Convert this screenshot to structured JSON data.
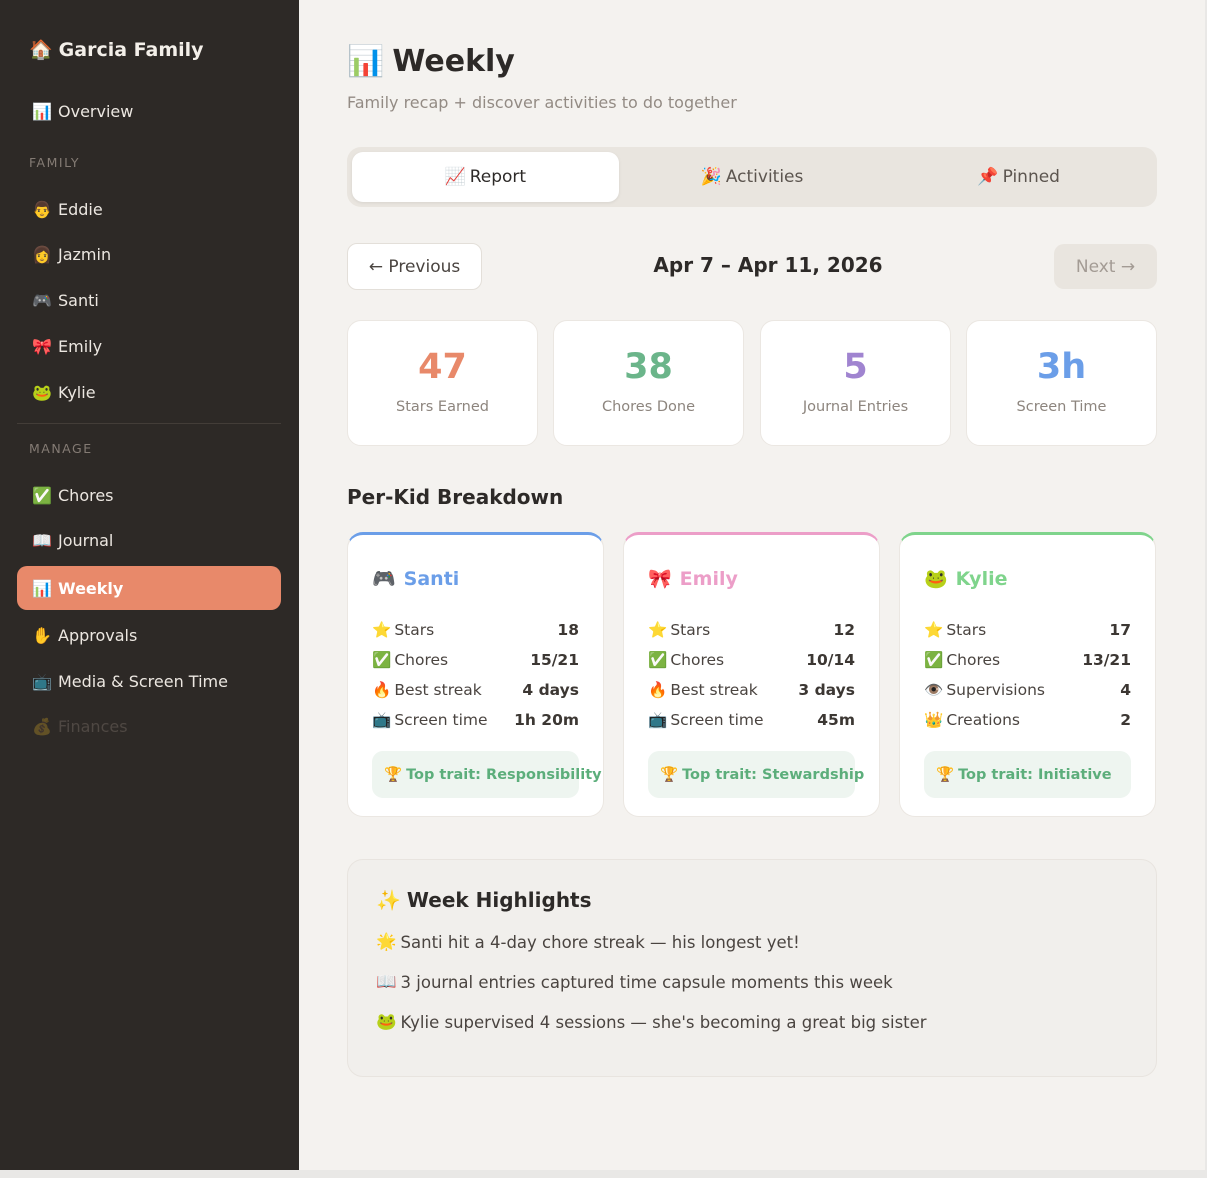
{
  "sidebar": {
    "brand": {
      "icon": "🏠",
      "label": "Garcia Family"
    },
    "overview": {
      "icon": "📊",
      "label": "Overview"
    },
    "family_label": "FAMILY",
    "family": [
      {
        "icon": "👨",
        "label": "Eddie"
      },
      {
        "icon": "👩",
        "label": "Jazmin"
      },
      {
        "icon": "🎮",
        "label": "Santi"
      },
      {
        "icon": "🎀",
        "label": "Emily"
      },
      {
        "icon": "🐸",
        "label": "Kylie"
      }
    ],
    "manage_label": "MANAGE",
    "manage": [
      {
        "icon": "✅",
        "label": "Chores"
      },
      {
        "icon": "📖",
        "label": "Journal"
      },
      {
        "icon": "📊",
        "label": "Weekly",
        "active": true
      },
      {
        "icon": "✋",
        "label": "Approvals"
      },
      {
        "icon": "📺",
        "label": "Media & Screen Time"
      },
      {
        "icon": "💰",
        "label": "Finances",
        "muted": true
      }
    ]
  },
  "header": {
    "icon": "📊",
    "title": "Weekly",
    "subtitle": "Family recap + discover activities to do together"
  },
  "tabs": [
    {
      "icon": "📈",
      "label": "Report",
      "active": true
    },
    {
      "icon": "🎉",
      "label": "Activities"
    },
    {
      "icon": "📌",
      "label": "Pinned"
    }
  ],
  "nav": {
    "prev": "← Previous",
    "next": "Next →",
    "date_range": "Apr 7 – Apr 11, 2026"
  },
  "stats": [
    {
      "value": "47",
      "label": "Stars Earned",
      "color": "#e8896a"
    },
    {
      "value": "38",
      "label": "Chores Done",
      "color": "#6bb58a"
    },
    {
      "value": "5",
      "label": "Journal Entries",
      "color": "#a084d0"
    },
    {
      "value": "3h",
      "label": "Screen Time",
      "color": "#6b9ee8"
    }
  ],
  "breakdown": {
    "title": "Per-Kid Breakdown",
    "kids": [
      {
        "icon": "🎮",
        "name": "Santi",
        "color": "#6b9ee8",
        "rows": [
          {
            "icon": "⭐",
            "label": "Stars",
            "value": "18"
          },
          {
            "icon": "✅",
            "label": "Chores",
            "value": "15/21"
          },
          {
            "icon": "🔥",
            "label": "Best streak",
            "value": "4 days"
          },
          {
            "icon": "📺",
            "label": "Screen time",
            "value": "1h 20m"
          }
        ],
        "trait": "Top trait: Responsibility"
      },
      {
        "icon": "🎀",
        "name": "Emily",
        "color": "#ec9ec8",
        "rows": [
          {
            "icon": "⭐",
            "label": "Stars",
            "value": "12"
          },
          {
            "icon": "✅",
            "label": "Chores",
            "value": "10/14"
          },
          {
            "icon": "🔥",
            "label": "Best streak",
            "value": "3 days"
          },
          {
            "icon": "📺",
            "label": "Screen time",
            "value": "45m"
          }
        ],
        "trait": "Top trait: Stewardship"
      },
      {
        "icon": "🐸",
        "name": "Kylie",
        "color": "#7fd48c",
        "rows": [
          {
            "icon": "⭐",
            "label": "Stars",
            "value": "17"
          },
          {
            "icon": "✅",
            "label": "Chores",
            "value": "13/21"
          },
          {
            "icon": "👁️",
            "label": "Supervisions",
            "value": "4"
          },
          {
            "icon": "👑",
            "label": "Creations",
            "value": "2"
          }
        ],
        "trait": "Top trait: Initiative"
      }
    ],
    "trait_icon": "🏆"
  },
  "highlights": {
    "icon": "✨",
    "title": "Week Highlights",
    "items": [
      {
        "icon": "🌟",
        "text": "Santi hit a 4-day chore streak — his longest yet!"
      },
      {
        "icon": "📖",
        "text": "3 journal entries captured time capsule moments this week"
      },
      {
        "icon": "🐸",
        "text": "Kylie supervised 4 sessions — she's becoming a great big sister"
      }
    ]
  }
}
